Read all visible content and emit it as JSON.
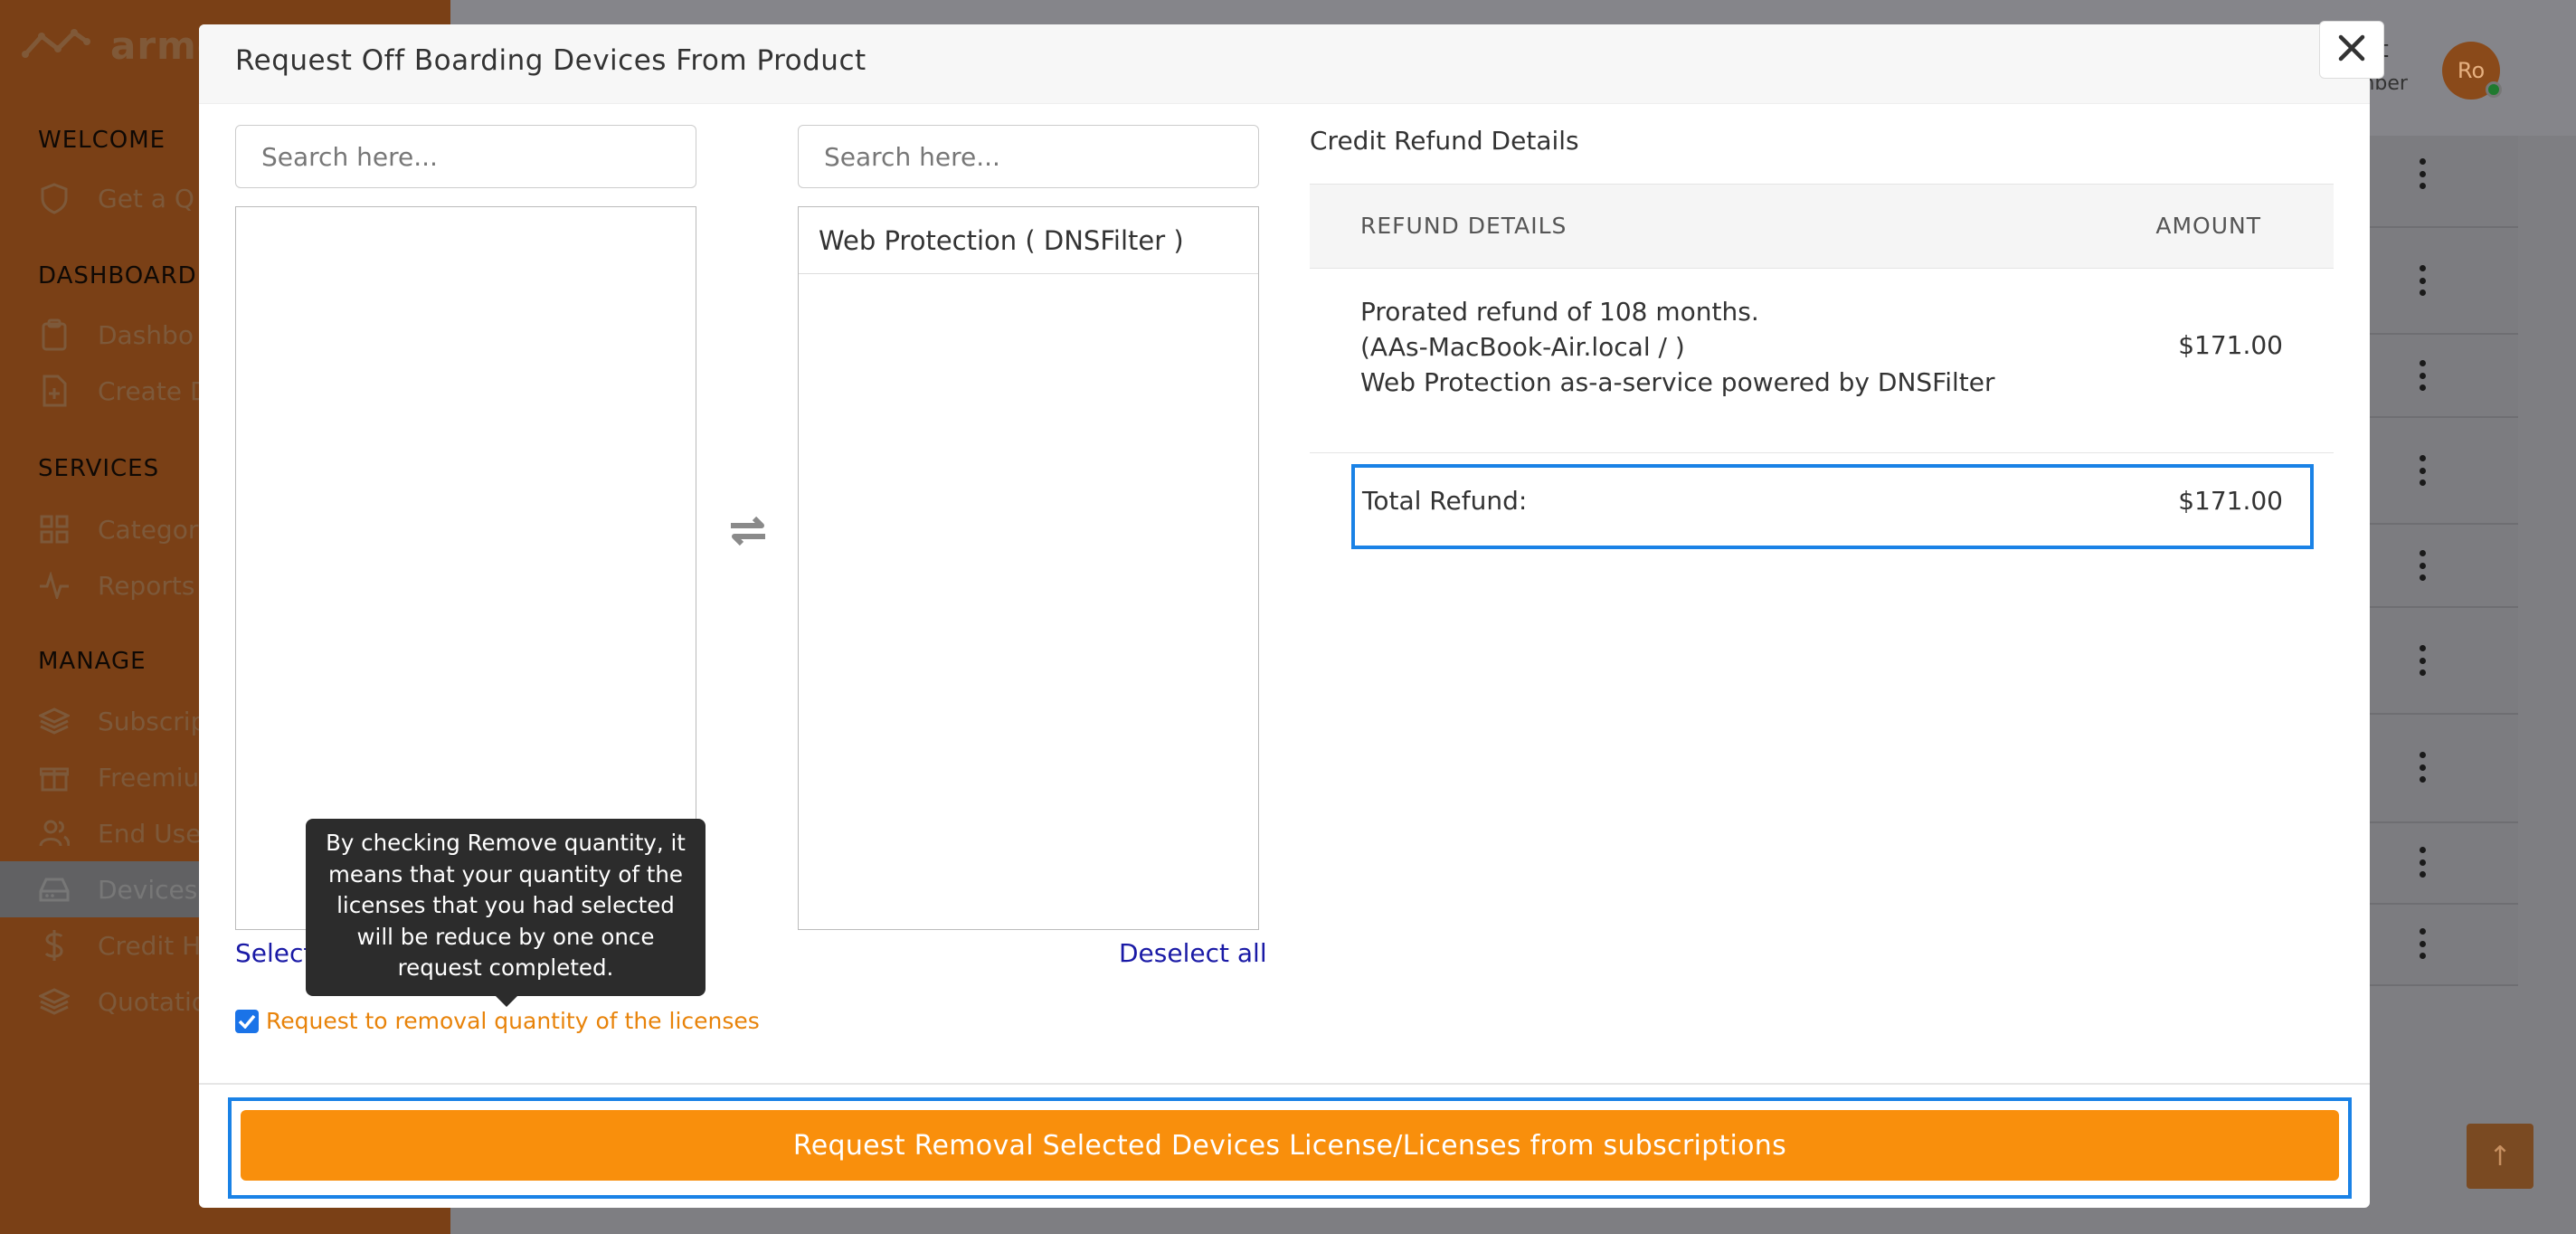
{
  "app": {
    "brand": "armo",
    "sidebar": {
      "sections": [
        {
          "label": "WELCOME",
          "items": [
            {
              "label": "Get a Q",
              "icon": "shield-icon"
            }
          ]
        },
        {
          "label": "DASHBOARD",
          "items": [
            {
              "label": "Dashbo",
              "icon": "clipboard-icon"
            },
            {
              "label": "Create D",
              "icon": "file-plus-icon"
            }
          ]
        },
        {
          "label": "SERVICES",
          "items": [
            {
              "label": "Categor",
              "icon": "grid-icon"
            },
            {
              "label": "Reports",
              "icon": "activity-icon"
            }
          ]
        },
        {
          "label": "MANAGE",
          "items": [
            {
              "label": "Subscrip",
              "icon": "layers-icon"
            },
            {
              "label": "Freemiu",
              "icon": "gift-icon"
            },
            {
              "label": "End Use",
              "icon": "users-icon"
            },
            {
              "label": "Devices",
              "icon": "hard-drive-icon",
              "active": true
            },
            {
              "label": "Credit H",
              "icon": "dollar-icon"
            },
            {
              "label": "Quotatio",
              "icon": "layers-icon"
            }
          ]
        }
      ]
    },
    "user": {
      "name": "ert",
      "role": "mber",
      "avatar_initials": "Ro"
    }
  },
  "modal": {
    "title": "Request Off Boarding Devices From Product",
    "close_icon": "close-icon",
    "left_list": {
      "search_placeholder": "Search here...",
      "items": [],
      "select_all_label": "Select"
    },
    "right_list": {
      "search_placeholder": "Search here...",
      "items": [
        "Web Protection ( DNSFilter )"
      ],
      "deselect_all_label": "Deselect all"
    },
    "remove_quantity": {
      "checked": true,
      "label": "Request to removal quantity of the licenses"
    },
    "tooltip_lines": [
      "By checking Remove quantity, it",
      "means that your quantity of the",
      "licenses that you had selected",
      "will be reduce by one once",
      "request completed."
    ],
    "refund": {
      "title": "Credit Refund Details",
      "col_details": "REFUND DETAILS",
      "col_amount": "AMOUNT",
      "rows": [
        {
          "lines": [
            "Prorated refund of 108 months.",
            "(AAs-MacBook-Air.local / )",
            "Web Protection as-a-service powered by DNSFilter"
          ],
          "amount": "$171.00"
        }
      ],
      "total_label": "Total Refund:",
      "total_amount": "$171.00"
    },
    "submit_label": "Request Removal Selected Devices License/Licenses from subscriptions"
  },
  "colors": {
    "accent": "#f98f0c",
    "highlight": "#1a82e6",
    "link": "#1a1aa6",
    "sidebar": "#e8833a"
  }
}
